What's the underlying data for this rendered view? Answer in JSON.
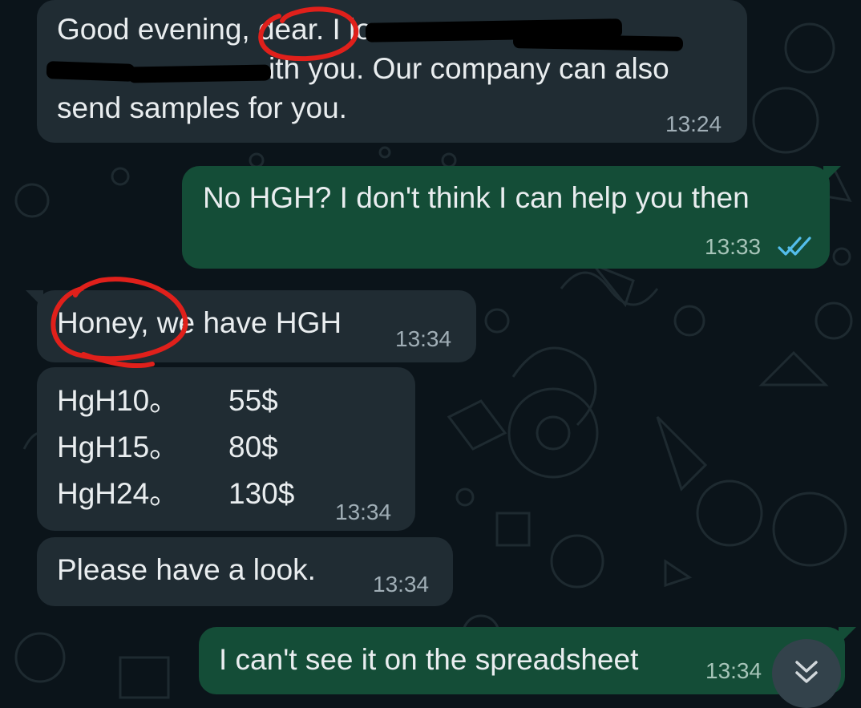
{
  "messages": [
    {
      "id": "m1",
      "direction": "incoming",
      "lines": [
        "Good evening, dear. I lo",
        "ith you. Our company can also",
        "send samples for you."
      ],
      "time": "13:24"
    },
    {
      "id": "m2",
      "direction": "outgoing",
      "text": "No HGH? I don't think I can help you then",
      "time": "13:33",
      "status": "read"
    },
    {
      "id": "m3",
      "direction": "incoming",
      "text": "Honey, we have HGH",
      "time": "13:34"
    },
    {
      "id": "m4",
      "direction": "incoming",
      "price_list": [
        {
          "product": "HgH10。",
          "price": "55$"
        },
        {
          "product": "HgH15。",
          "price": "80$"
        },
        {
          "product": "HgH24。",
          "price": "130$"
        }
      ],
      "time": "13:34"
    },
    {
      "id": "m5",
      "direction": "incoming",
      "text": "Please have a look.",
      "time": "13:34"
    },
    {
      "id": "m6",
      "direction": "outgoing",
      "text": "I can't see it on the spreadsheet",
      "time": "13:34"
    }
  ],
  "icons": {
    "read_ticks": "double-check-icon",
    "scroll_down": "chevron-double-down-icon"
  },
  "colors": {
    "background": "#0b141a",
    "incoming_bubble": "#202c33",
    "outgoing_bubble": "#144d37",
    "read_tick": "#53bdeb",
    "annotation": "#e0201b"
  }
}
